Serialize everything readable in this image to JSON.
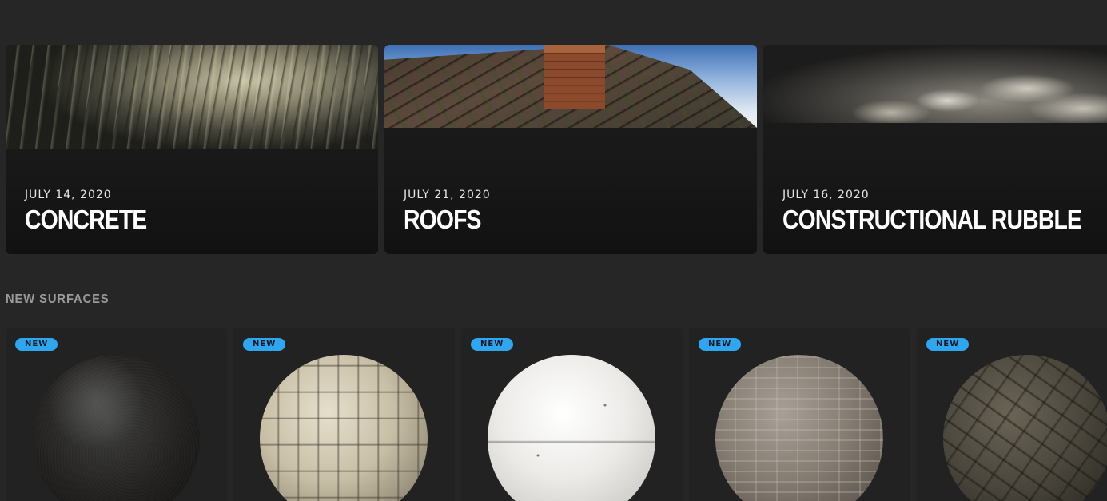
{
  "collections": [
    {
      "date": "JULY 14, 2020",
      "title": "CONCRETE"
    },
    {
      "date": "JULY 21, 2020",
      "title": "ROOFS"
    },
    {
      "date": "JULY 16, 2020",
      "title": "CONSTRUCTIONAL RUBBLE"
    }
  ],
  "new_surfaces": {
    "heading": "NEW SURFACES",
    "badge_label": "NEW",
    "badge_color": "#2ea6f0"
  }
}
